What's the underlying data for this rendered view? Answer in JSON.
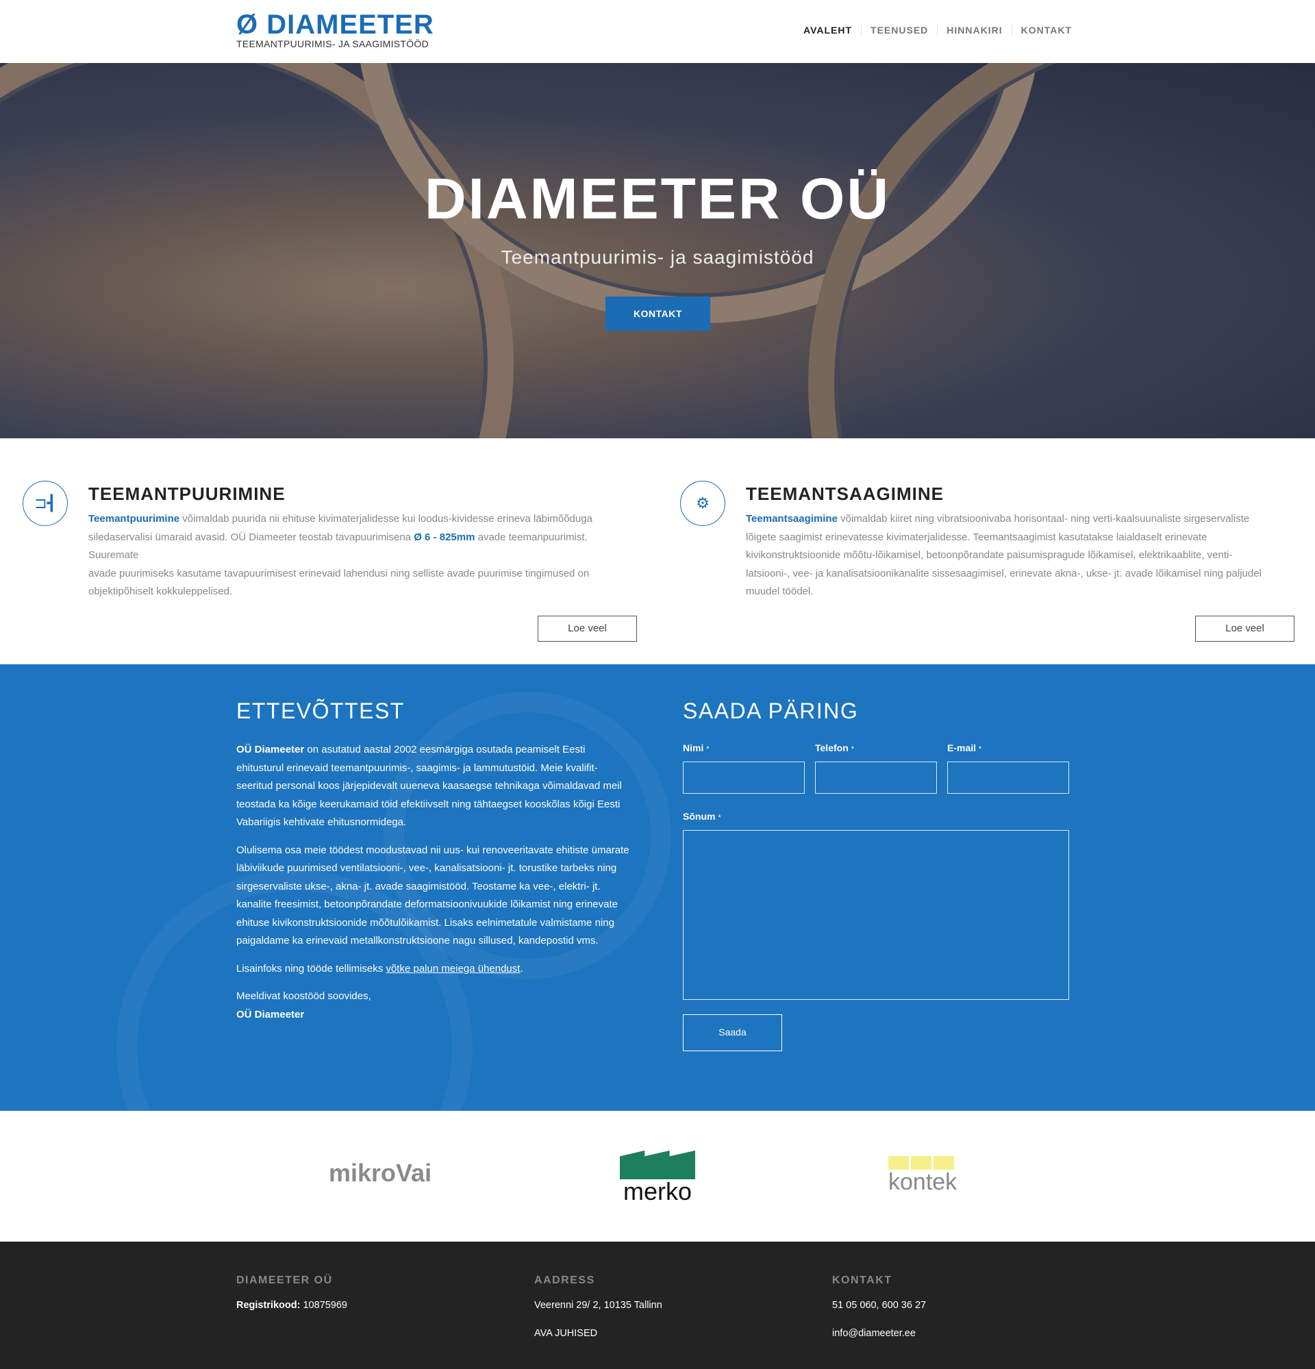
{
  "header": {
    "logo_symbol": "Ø",
    "logo_name": "DIAMEETER",
    "logo_tagline": "TEEMANTPUURIMIS- JA SAAGIMISTÖÖD",
    "nav": [
      "AVALEHT",
      "TEENUSED",
      "HINNAKIRI",
      "KONTAKT"
    ],
    "active_nav": "AVALEHT"
  },
  "hero": {
    "title": "DIAMEETER OÜ",
    "subtitle": "Teemantpuurimis- ja saagimistööd",
    "button": "KONTAKT"
  },
  "services": [
    {
      "icon": "drill-icon",
      "title": "TEEMANTPUURIMINE",
      "lead": "Teemantpuurimine",
      "text1": " võimaldab puurida nii ehituse kivimaterjalidesse kui loodus-kividesse erineva läbimõõduga siledaservalisi ümaraid avasid. OÜ Diameeter teostab tavapuurimisena ",
      "highlight": "Ø 6 - 825mm",
      "text2": " avade teemanpuurimist. Suuremate",
      "text3": "avade puurimiseks kasutame tavapuurimisest erinevaid lahendusi ning selliste avade puurimise tingimused on objektipõhiselt kokkuleppelised.",
      "button": "Loe veel"
    },
    {
      "icon": "saw-blade-icon",
      "title": "TEEMANTSAAGIMINE",
      "lead": "Teemantsaagimine",
      "text1": " võimaldab kiiret ning vibratsioonivaba horisontaal- ning verti-kaalsuunaliste sirgeservaliste lõigete saagimist erinevatesse kivimaterjalidesse. Teemantsaagimist kasutatakse laialdaselt erinevate kivikonstruktsioonide mõõtu-lõikamisel, betoonpõrandate paisumispragude lõikamisel, elektrikaablite, venti-latsiooni-, vee- ja kanalisatsioonikanalite sissesaagimisel, erinevate akna-, ukse- jt. avade lõikamisel ning paljudel muudel töödel.",
      "button": "Loe veel"
    }
  ],
  "about": {
    "title": "ETTEVÕTTEST",
    "p1_bold": "OÜ Diameeter",
    "p1": " on asutatud aastal 2002 eesmärgiga osutada peamiselt Eesti ehitusturul erinevaid teemantpuurimis-, saagimis- ja lammutustöid. Meie kvalifit-seeritud personal koos järjepidevalt uueneva kaasaegse tehnikaga võimaldavad meil teostada ka kõige keerukamaid töid efektiivselt ning tähtaegset kooskõlas kõigi Eesti Vabariigis kehtivate ehitusnormidega.",
    "p2": "Olulisema osa meie töödest moodustavad nii uus- kui renoveeritavate ehitiste ümarate läbiviikude puurimised ventilatsiooni-, vee-, kanalisatsiooni- jt. torustike tarbeks ning sirgeservaliste ukse-, akna- jt. avade saagimistööd. Teostame ka vee-, elektri- jt. kanalite freesimist, betoonpõrandate deformatsioonivuukide lõikamist ning erinevate ehituse kivikonstruktsioonide mõõtulõikamist. Lisaks eelnimetatule valmistame ning paigaldame ka erinevaid metallkonstruktsioone nagu sillused, kandepostid vms.",
    "p3": "Lisainfoks ning tööde tellimiseks ",
    "p3_link": "võtke palun meiega ühendust",
    "p3_end": ".",
    "closing": "Meeldivat koostööd soovides,",
    "signature": "OÜ Diameeter"
  },
  "form": {
    "title": "SAADA PÄRING",
    "required_mark": "*",
    "name_label": "Nimi",
    "name_value": "",
    "phone_label": "Telefon",
    "phone_value": "",
    "email_label": "E-mail",
    "email_value": "",
    "message_label": "Sõnum",
    "message_value": "",
    "submit": "Saada"
  },
  "partners": [
    "mikroVai",
    "merko",
    "kontek"
  ],
  "footer": {
    "col1_title": "DIAMEETER OÜ",
    "reg_label": "Registrikood:",
    "reg_value": " 10875969",
    "col2_title": "AADRESS",
    "address": "Veerenni 29/ 2, 10135 Tallinn",
    "directions": "AVA JUHISED",
    "col3_title": "KONTAKT",
    "phones": "51 05 060, 600 36 27",
    "email": "info@diameeter.ee"
  },
  "colors": {
    "brand_blue": "#1b6cb5",
    "section_blue": "#1d74bf",
    "footer_bg": "#232323"
  }
}
